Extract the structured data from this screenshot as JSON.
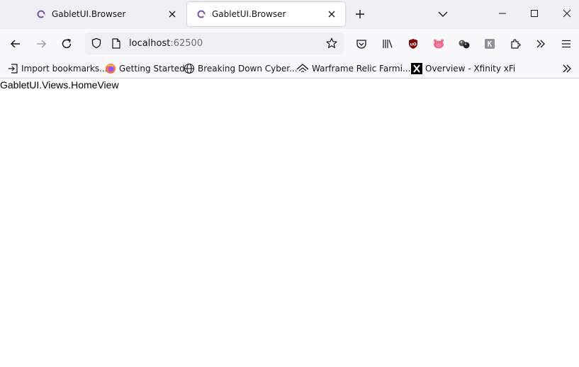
{
  "tabs": [
    {
      "title": "GabletUI.Browser",
      "active": false
    },
    {
      "title": "GabletUI.Browser",
      "active": true
    }
  ],
  "toolbar": {
    "icons": [
      "back-icon",
      "forward-icon",
      "reload-icon",
      "pocket-icon",
      "library-icon",
      "ublock-icon",
      "pig-extension-icon",
      "extension-orbs-icon",
      "k-extension-icon",
      "extensions-puzzle-icon",
      "overflow-chevrons-icon",
      "app-menu-icon"
    ]
  },
  "url": {
    "host": "localhost",
    "port": ":62500"
  },
  "bookmarks": [
    {
      "label": "Import bookmarks...",
      "icon": "import-icon"
    },
    {
      "label": "Getting Started",
      "icon": "firefox-icon"
    },
    {
      "label": "Breaking Down Cyber...",
      "icon": "globe-icon"
    },
    {
      "label": "Warframe Relic Farmi...",
      "icon": "warframe-icon"
    },
    {
      "label": "Overview - Xfinity xFi",
      "icon": "x-icon"
    }
  ],
  "content": {
    "text": "GabletUI.Views.HomeView"
  },
  "colors": {
    "tabstrip": "#f0f0f4",
    "toolbar": "#f9f9fb",
    "favicon": "#7b4fa8",
    "ublock": "#800000",
    "pig": "#ef6b8e"
  }
}
